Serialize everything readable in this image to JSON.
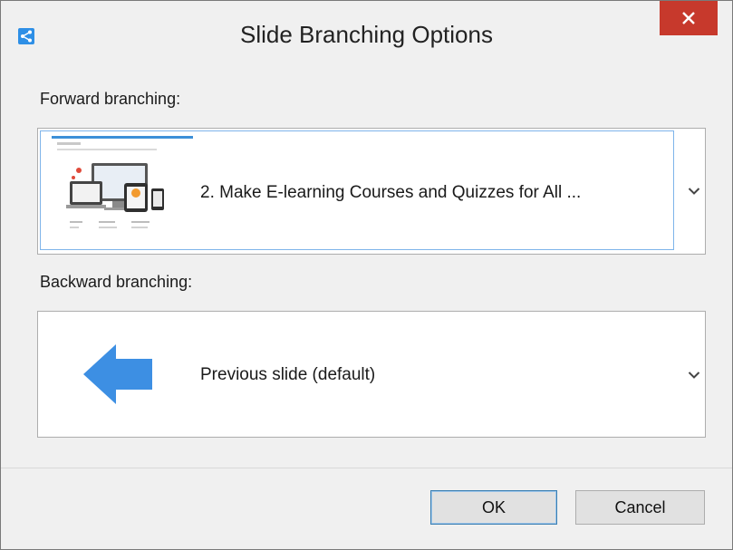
{
  "window": {
    "title": "Slide Branching Options"
  },
  "forward": {
    "label": "Forward branching:",
    "selected": "2. Make E-learning Courses and Quizzes for All ..."
  },
  "backward": {
    "label": "Backward branching:",
    "selected": "Previous slide (default)"
  },
  "buttons": {
    "ok": "OK",
    "cancel": "Cancel"
  },
  "colors": {
    "close": "#c7392c",
    "accent": "#3c8fd8",
    "arrow": "#3d8fe3"
  },
  "icons": [
    "share-icon",
    "close-icon",
    "chevron-down-icon",
    "slide-thumbnail",
    "arrow-left-icon"
  ]
}
